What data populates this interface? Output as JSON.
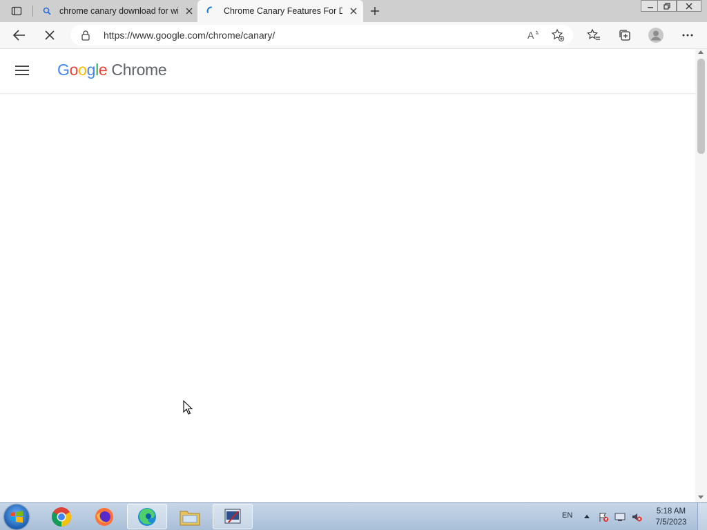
{
  "browser": {
    "tabs": [
      {
        "title": "chrome canary download for wir",
        "icon": "search-icon",
        "active": false
      },
      {
        "title": "Chrome Canary Features For Dev",
        "icon": "loading-spinner-icon",
        "active": true
      }
    ],
    "address_bar": {
      "url": "https://www.google.com/chrome/canary/"
    }
  },
  "page": {
    "brand": {
      "google_letters": [
        "G",
        "o",
        "o",
        "g",
        "l",
        "e"
      ],
      "google_colors": [
        "#4285F4",
        "#EA4335",
        "#FBBC05",
        "#4285F4",
        "#34A853",
        "#EA4335"
      ],
      "product": "Chrome"
    }
  },
  "taskbar": {
    "items": [
      "chrome-icon",
      "firefox-icon",
      "edge-icon",
      "file-explorer-icon",
      "screen-tool-icon"
    ],
    "active_item": "edge-icon",
    "language": "EN",
    "time": "5:18 AM",
    "date": "7/5/2023"
  }
}
